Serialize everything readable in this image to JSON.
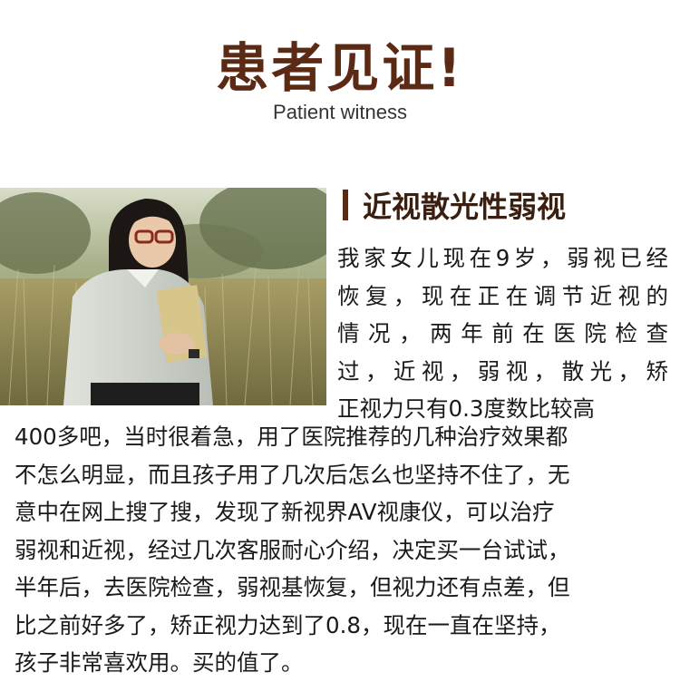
{
  "header": {
    "title": "患者见证!",
    "subtitle": "Patient witness"
  },
  "section": {
    "heading": "近视散光性弱视"
  },
  "testimonial": {
    "side_lines": [
      "我家女儿现在9岁，弱视已经",
      "恢复，现在正在调节近视的",
      "情况，两年前在医院检查",
      "过，近视，弱视，散光，矫",
      "正视力只有0.3度数比较高"
    ],
    "full_lines": [
      "400多吧，当时很着急，用了医院推荐的几种治疗效果都",
      "不怎么明显，而且孩子用了几次后怎么也坚持不住了，无",
      "意中在网上搜了搜，发现了新视界AV视康仪，可以治疗",
      "弱视和近视，经过几次客服耐心介绍，决定买一台试试，",
      "半年后，去医院检查，弱视基恢复，但视力还有点差，但",
      "比之前好多了，矫正视力达到了0.8，现在一直在坚持，",
      "孩子非常喜欢用。买的值了。"
    ]
  }
}
